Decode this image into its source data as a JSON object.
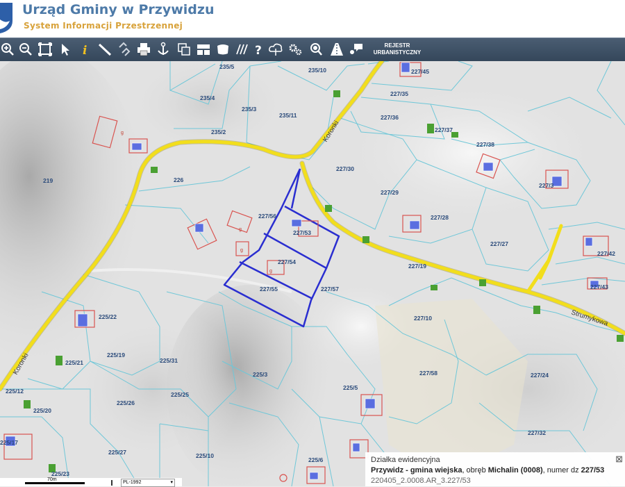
{
  "header": {
    "title": "Urząd Gminy w Przywidzu",
    "subtitle": "System Informacji Przestrzennej"
  },
  "toolbar": {
    "tools": [
      "zoom-in-icon",
      "zoom-out-icon",
      "zoom-extent-icon",
      "pointer-icon",
      "info-icon",
      "measure-length-icon",
      "link-icon",
      "print-icon",
      "anchor-icon",
      "copy-icon",
      "layout-icon",
      "shape-icon",
      "hatch-icon",
      "help-icon",
      "cloud-download-icon",
      "settings-icon",
      "search-zoom-icon",
      "road-icon",
      "chat-icon"
    ],
    "register_line1": "REJESTR",
    "register_line2": "URBANISTYCZNY"
  },
  "map": {
    "streets": [
      "Koronki",
      "Koronki",
      "Strumykowa"
    ],
    "parcels": [
      "235/5",
      "235/10",
      "227/45",
      "227/35",
      "235/4",
      "235/3",
      "235/11",
      "227/36",
      "227/37",
      "235/2",
      "227/38",
      "219",
      "226",
      "227/30",
      "227/3",
      "227/29",
      "227/56",
      "227/53",
      "227/28",
      "227/54",
      "227/27",
      "227/42",
      "227/19",
      "227/55",
      "227/57",
      "227/43",
      "227/10",
      "225/22",
      "225/19",
      "225/21",
      "225/31",
      "227/58",
      "227/24",
      "225/12",
      "225/3",
      "225/5",
      "225/26",
      "225/25",
      "225/20",
      "225/17",
      "225/27",
      "225/10",
      "227/32",
      "225/6",
      "225/23"
    ],
    "building_label": "g"
  },
  "scale": {
    "distance": "70m",
    "crs": "PL-1992"
  },
  "popup": {
    "header": "Działka ewidencyjna",
    "commune": "Przywidz - gmina wiejska",
    "sep1": ", obręb ",
    "precinct": "Michalin (0008)",
    "sep2": ", numer dz ",
    "parcel": "227/53",
    "id": "220405_2.0008.AR_3.227/53",
    "close": "⊠"
  }
}
